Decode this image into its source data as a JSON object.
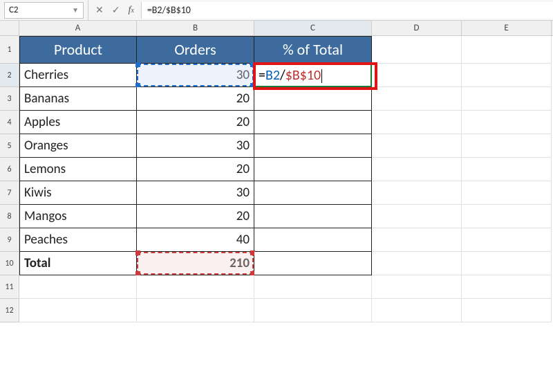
{
  "nameBox": {
    "value": "C2"
  },
  "formulaBar": {
    "text": "=B2/$B$10"
  },
  "columns": [
    "A",
    "B",
    "C",
    "D",
    "E"
  ],
  "rowNumbers": [
    "1",
    "2",
    "3",
    "4",
    "5",
    "6",
    "7",
    "8",
    "9",
    "10",
    "11",
    "12"
  ],
  "headers": {
    "a": "Product",
    "b": "Orders",
    "c": "% of Total"
  },
  "data": {
    "r2": {
      "a": "Cherries",
      "b": "30"
    },
    "r3": {
      "a": "Bananas",
      "b": "20"
    },
    "r4": {
      "a": "Apples",
      "b": "20"
    },
    "r5": {
      "a": "Oranges",
      "b": "30"
    },
    "r6": {
      "a": "Lemons",
      "b": "20"
    },
    "r7": {
      "a": "Kiwis",
      "b": "30"
    },
    "r8": {
      "a": "Mangos",
      "b": "20"
    },
    "r9": {
      "a": "Peaches",
      "b": "40"
    },
    "r10": {
      "a": "Total",
      "b": "210"
    }
  },
  "editCell": {
    "eq": "=",
    "ref1": "B2",
    "slash": "/",
    "ref2": "$B$10"
  },
  "chart_data": {
    "type": "table",
    "columns": [
      "Product",
      "Orders",
      "% of Total"
    ],
    "rows": [
      [
        "Cherries",
        30,
        null
      ],
      [
        "Bananas",
        20,
        null
      ],
      [
        "Apples",
        20,
        null
      ],
      [
        "Oranges",
        30,
        null
      ],
      [
        "Lemons",
        20,
        null
      ],
      [
        "Kiwis",
        30,
        null
      ],
      [
        "Mangos",
        20,
        null
      ],
      [
        "Peaches",
        40,
        null
      ],
      [
        "Total",
        210,
        null
      ]
    ]
  }
}
